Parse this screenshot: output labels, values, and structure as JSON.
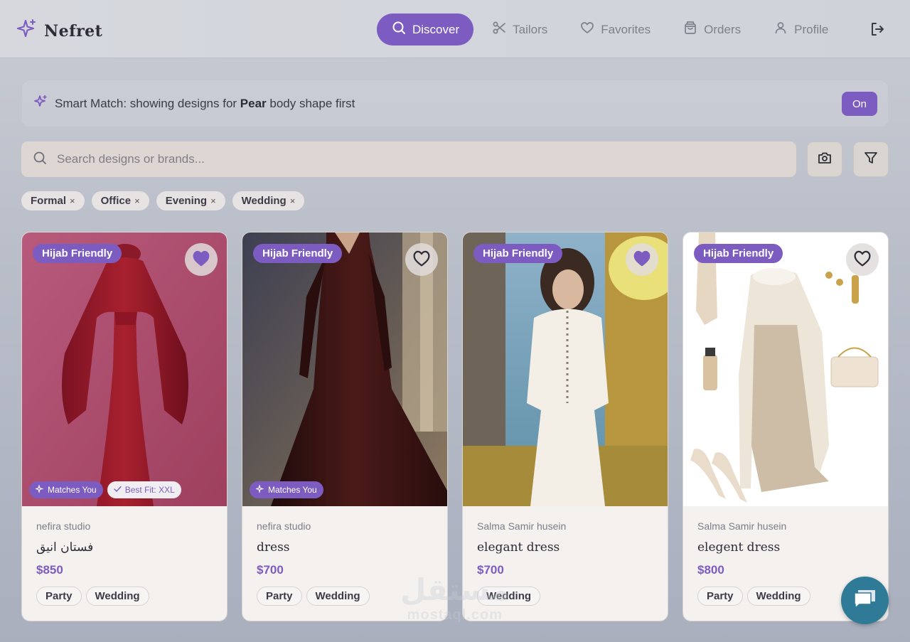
{
  "header": {
    "logo_text": "Nefret",
    "nav": [
      {
        "label": "Discover",
        "icon": "search-icon",
        "active": true
      },
      {
        "label": "Tailors",
        "icon": "scissors-icon"
      },
      {
        "label": "Favorites",
        "icon": "heart-icon"
      },
      {
        "label": "Orders",
        "icon": "shopping-bag-icon"
      },
      {
        "label": "Profile",
        "icon": "user-icon"
      }
    ],
    "logout_icon": "logout-icon"
  },
  "smart_match": {
    "prefix": "Smart Match: showing designs for ",
    "shape": "Pear",
    "suffix": " body shape first",
    "toggle_label": "On"
  },
  "search": {
    "placeholder": "Search designs or brands..."
  },
  "filters": [
    "Formal",
    "Office",
    "Evening",
    "Wedding"
  ],
  "filter_remove_symbol": "×",
  "cards": [
    {
      "badge": "Hijab Friendly",
      "favorited": true,
      "matches_you": "Matches You",
      "best_fit": "Best Fit: XXL",
      "brand": "nefira studio",
      "name": "فستان انيق",
      "price": "$850",
      "tags": [
        "Party",
        "Wedding"
      ]
    },
    {
      "badge": "Hijab Friendly",
      "favorited": false,
      "matches_you": "Matches You",
      "brand": "nefira studio",
      "name": "dress",
      "price": "$700",
      "tags": [
        "Party",
        "Wedding"
      ]
    },
    {
      "badge": "Hijab Friendly",
      "favorited": true,
      "brand": "Salma Samir husein",
      "name": "elegant dress",
      "price": "$700",
      "tags": [
        "Wedding"
      ]
    },
    {
      "badge": "Hijab Friendly",
      "favorited": false,
      "brand": "Salma Samir husein",
      "name": "elegent dress",
      "price": "$800",
      "tags": [
        "Party",
        "Wedding"
      ]
    }
  ],
  "watermark": {
    "arabic": "مستقل",
    "latin": "mostaql.com"
  },
  "colors": {
    "accent": "#7d5cc2",
    "chat": "#2f7a96"
  }
}
